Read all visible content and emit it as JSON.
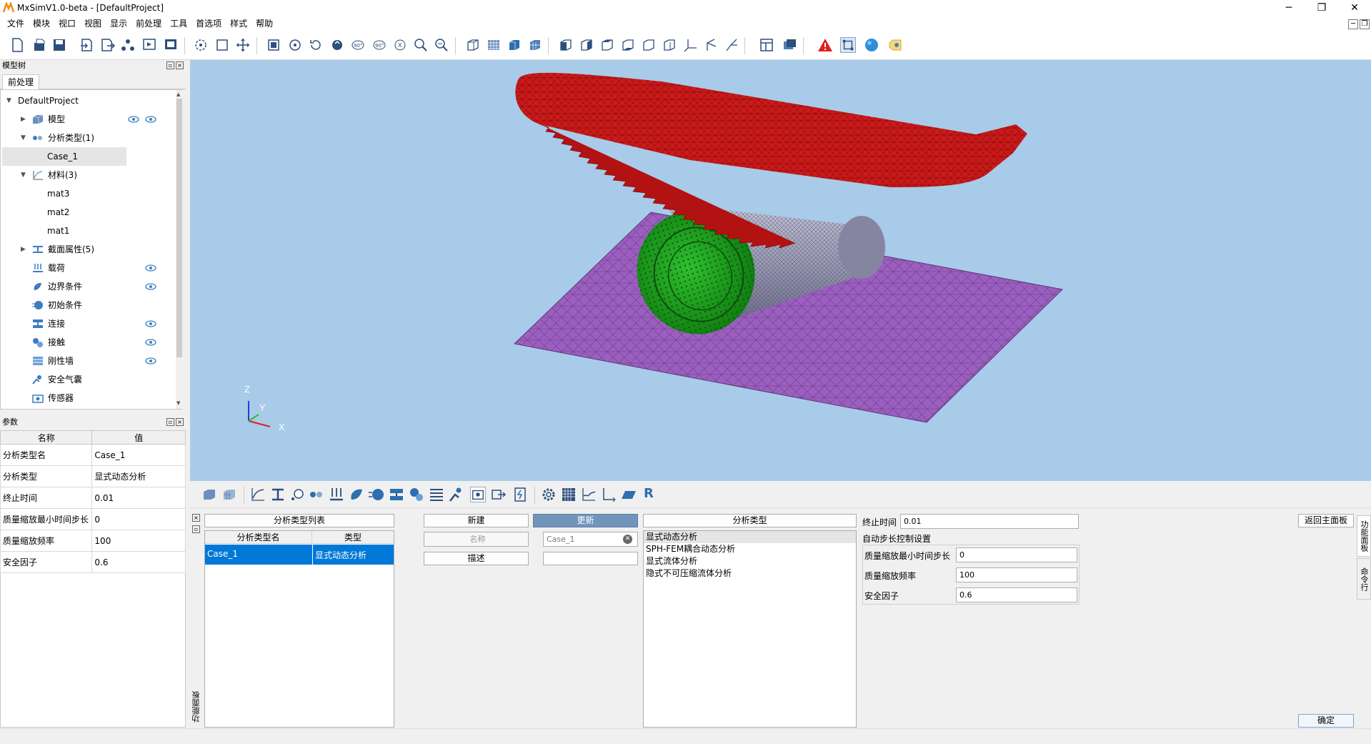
{
  "window": {
    "title": "MxSimV1.0-beta - [DefaultProject]"
  },
  "menu": [
    "文件",
    "模块",
    "视口",
    "视图",
    "显示",
    "前处理",
    "工具",
    "首选项",
    "样式",
    "帮助"
  ],
  "tree_panel": {
    "title": "模型树",
    "tab": "前处理",
    "root": "DefaultProject",
    "items": [
      {
        "label": "模型",
        "icon": "cube-icon",
        "eye": true,
        "eye2": true
      },
      {
        "label": "分析类型(1)",
        "icon": "analysis-icon"
      },
      {
        "label": "Case_1"
      },
      {
        "label": "材料(3)",
        "icon": "material-curve-icon"
      },
      {
        "label": "mat3"
      },
      {
        "label": "mat2"
      },
      {
        "label": "mat1"
      },
      {
        "label": "截面属性(5)",
        "icon": "section-icon"
      },
      {
        "label": "载荷",
        "icon": "load-icon",
        "eye": true
      },
      {
        "label": "边界条件",
        "icon": "boundary-icon",
        "eye": true
      },
      {
        "label": "初始条件",
        "icon": "initial-condition-icon"
      },
      {
        "label": "连接",
        "icon": "connection-icon",
        "eye": true
      },
      {
        "label": "接触",
        "icon": "contact-icon",
        "eye": true
      },
      {
        "label": "刚性墙",
        "icon": "rigid-wall-icon",
        "eye": true
      },
      {
        "label": "安全气囊",
        "icon": "airbag-icon"
      },
      {
        "label": "传感器",
        "icon": "sensor-icon"
      }
    ]
  },
  "params_panel": {
    "title": "参数",
    "headers": [
      "名称",
      "值"
    ],
    "rows": [
      {
        "name": "分析类型名",
        "value": "Case_1"
      },
      {
        "name": "分析类型",
        "value": "显式动态分析"
      },
      {
        "name": "终止时间",
        "value": "0.01"
      },
      {
        "name": "质量缩放最小时间步长",
        "value": "0"
      },
      {
        "name": "质量缩放频率",
        "value": "100"
      },
      {
        "name": "安全因子",
        "value": "0.6"
      }
    ]
  },
  "viewport": {
    "axes": {
      "x": "X",
      "y": "Y",
      "z": "Z"
    }
  },
  "function_panel": {
    "side_label": "功能面板",
    "list_header": "分析类型列表",
    "list_columns": [
      "分析类型名",
      "类型"
    ],
    "list_rows": [
      {
        "name": "Case_1",
        "type": "显式动态分析"
      }
    ],
    "new_label": "新建",
    "update_label": "更新",
    "name_placeholder": "名称",
    "name_value": "Case_1",
    "describe_label": "描述",
    "type_header": "分析类型",
    "type_options": [
      "显式动态分析",
      "SPH-FEM耦合动态分析",
      "显式流体分析",
      "隐式不可压缩流体分析"
    ],
    "end_time_label": "终止时间",
    "end_time_value": "0.01",
    "auto_step_label": "自动步长控制设置",
    "min_step_label": "质量缩放最小时间步长",
    "min_step_value": "0",
    "freq_label": "质量缩放频率",
    "freq_value": "100",
    "safety_label": "安全因子",
    "safety_value": "0.6",
    "back_label": "返回主面板",
    "confirm_label": "确定",
    "right_tabs": [
      "功能面板",
      "命令行"
    ]
  },
  "colors": {
    "viewport_bg": "#a8cbe9",
    "red_part": "#cc1a1a",
    "green_part": "#1f9e1f",
    "purple_plate": "#9b5fc0",
    "cylinder": "#9494b0",
    "selection": "#0078d7"
  }
}
